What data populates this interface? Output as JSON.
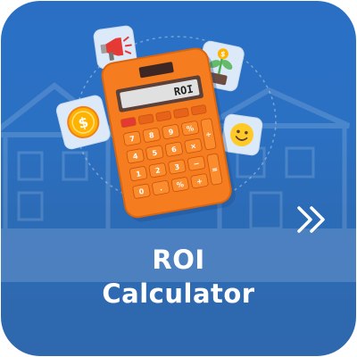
{
  "card": {
    "title_line1": "ROI",
    "title_line2": "Calculator",
    "accent_color": "#2b6fc3",
    "calculator_color": "#f57c1f",
    "display_text": "ROI"
  },
  "icons": {
    "megaphone": "megaphone-icon",
    "plant": "plant-growth-icon",
    "coin": "dollar-coin-icon",
    "smiley": "smiley-face-icon",
    "next": "double-chevron-right-icon"
  }
}
